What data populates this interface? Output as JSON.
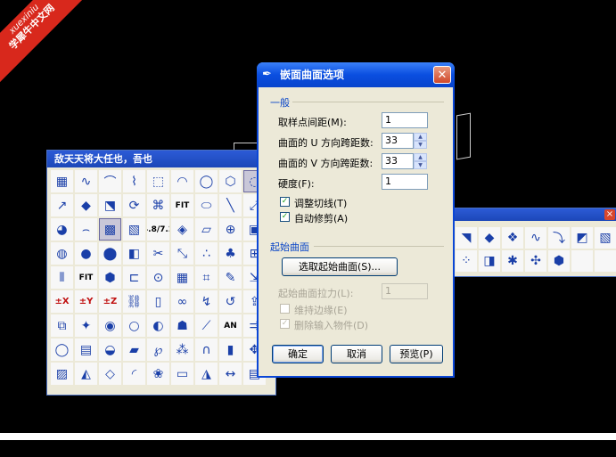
{
  "watermark": {
    "line1": "xuexiniu",
    "line2": "学犀牛中文网"
  },
  "left_toolbar": {
    "title": "敌天天将大任也，吾也",
    "tools": [
      {
        "icon": "color-swatch-icon",
        "glyph": "▦"
      },
      {
        "icon": "curve-icon",
        "glyph": "∿"
      },
      {
        "icon": "polyline-icon",
        "glyph": "⌒"
      },
      {
        "icon": "freeform-curve-icon",
        "glyph": "⌇"
      },
      {
        "icon": "rectangle-dashed-icon",
        "glyph": "⬚"
      },
      {
        "icon": "arc-icon",
        "glyph": "◠"
      },
      {
        "icon": "circle-icon",
        "glyph": "◯"
      },
      {
        "icon": "polygon-icon",
        "glyph": "⬡"
      },
      {
        "icon": "ellipse-icon",
        "glyph": "◌"
      },
      {
        "icon": "line-arrow-icon",
        "glyph": "↗"
      },
      {
        "icon": "surface-icon",
        "glyph": "◆"
      },
      {
        "icon": "loft-icon",
        "glyph": "⬔"
      },
      {
        "icon": "revolve-icon",
        "glyph": "⟳"
      },
      {
        "icon": "sweep-icon",
        "glyph": "⌘"
      },
      {
        "icon": "fit-icon",
        "glyph": "FIT"
      },
      {
        "icon": "cylinder-icon",
        "glyph": "⬭"
      },
      {
        "icon": "pipe-icon",
        "glyph": "╲"
      },
      {
        "icon": "extend-icon",
        "glyph": "⤢"
      },
      {
        "icon": "fillet-icon",
        "glyph": "◕"
      },
      {
        "icon": "blend-icon",
        "glyph": "⌢"
      },
      {
        "icon": "patch-icon",
        "glyph": "▩"
      },
      {
        "icon": "network-surface-icon",
        "glyph": "▧"
      },
      {
        "icon": "fraction-icon",
        "glyph": "4.8/7.2"
      },
      {
        "icon": "plane-icon",
        "glyph": "◈"
      },
      {
        "icon": "offset-icon",
        "glyph": "▱"
      },
      {
        "icon": "sphere-wire-icon",
        "glyph": "⊕"
      },
      {
        "icon": "box-icon",
        "glyph": "▣"
      },
      {
        "icon": "sphere-icon",
        "glyph": "◍"
      },
      {
        "icon": "ball-icon",
        "glyph": "●"
      },
      {
        "icon": "solid-sphere-icon",
        "glyph": "⬤"
      },
      {
        "icon": "split-icon",
        "glyph": "◧"
      },
      {
        "icon": "trim-icon",
        "glyph": "✂"
      },
      {
        "icon": "scale-icon",
        "glyph": "⤡"
      },
      {
        "icon": "points-icon",
        "glyph": "∴"
      },
      {
        "icon": "group-icon",
        "glyph": "♣"
      },
      {
        "icon": "select-icon",
        "glyph": "⊞"
      },
      {
        "icon": "mirror-icon",
        "glyph": "⫴"
      },
      {
        "icon": "fit-curve-icon",
        "glyph": "FIT"
      },
      {
        "icon": "cube-icon",
        "glyph": "⬢"
      },
      {
        "icon": "explode-icon",
        "glyph": "⊏"
      },
      {
        "icon": "target-icon",
        "glyph": "⊙"
      },
      {
        "icon": "hatch-icon",
        "glyph": "▦"
      },
      {
        "icon": "grid-icon",
        "glyph": "⌗"
      },
      {
        "icon": "brush-icon",
        "glyph": "✎"
      },
      {
        "icon": "move-icon",
        "glyph": "⇲"
      },
      {
        "icon": "dim-x-icon",
        "glyph": "±X"
      },
      {
        "icon": "dim-y-icon",
        "glyph": "±Y"
      },
      {
        "icon": "dim-z-icon",
        "glyph": "±Z"
      },
      {
        "icon": "chain-icon",
        "glyph": "⛓"
      },
      {
        "icon": "edge-icon",
        "glyph": "▯"
      },
      {
        "icon": "link-icon",
        "glyph": "∞"
      },
      {
        "icon": "path-icon",
        "glyph": "↯"
      },
      {
        "icon": "loop-icon",
        "glyph": "↺"
      },
      {
        "icon": "extrude-icon",
        "glyph": "⇪"
      },
      {
        "icon": "layout-icon",
        "glyph": "⧉"
      },
      {
        "icon": "render-icon",
        "glyph": "✦"
      },
      {
        "icon": "light-icon",
        "glyph": "◉"
      },
      {
        "icon": "sphere-light-icon",
        "glyph": "○"
      },
      {
        "icon": "globe-icon",
        "glyph": "◐"
      },
      {
        "icon": "walk-icon",
        "glyph": "☗"
      },
      {
        "icon": "measure-icon",
        "glyph": "⟋"
      },
      {
        "icon": "annotation-icon",
        "glyph": "AN"
      },
      {
        "icon": "arrows-icon",
        "glyph": "⇉"
      },
      {
        "icon": "circle-red-icon",
        "glyph": "◯"
      },
      {
        "icon": "gradient-icon",
        "glyph": "▤"
      },
      {
        "icon": "disc-icon",
        "glyph": "◒"
      },
      {
        "icon": "panel-icon",
        "glyph": "▰"
      },
      {
        "icon": "loop-curve-icon",
        "glyph": "℘"
      },
      {
        "icon": "scatter-icon",
        "glyph": "⁂"
      },
      {
        "icon": "arch-icon",
        "glyph": "∩"
      },
      {
        "icon": "block-icon",
        "glyph": "▮"
      },
      {
        "icon": "pan-icon",
        "glyph": "✥"
      },
      {
        "icon": "stripes-icon",
        "glyph": "▨"
      },
      {
        "icon": "shaded-icon",
        "glyph": "◭"
      },
      {
        "icon": "tile-icon",
        "glyph": "◇"
      },
      {
        "icon": "ribbon-icon",
        "glyph": "◜"
      },
      {
        "icon": "material-icon",
        "glyph": "❀"
      },
      {
        "icon": "paper-icon",
        "glyph": "▭"
      },
      {
        "icon": "mesh-icon",
        "glyph": "◮"
      },
      {
        "icon": "dimension-icon",
        "glyph": "↔"
      },
      {
        "icon": "toolbar-icon",
        "glyph": "▤"
      }
    ]
  },
  "right_toolbar": {
    "close": "×",
    "tools": [
      {
        "icon": "surface-edge-icon",
        "glyph": "◥"
      },
      {
        "icon": "surface-tile-icon",
        "glyph": "◆"
      },
      {
        "icon": "diamonds-icon",
        "glyph": "❖"
      },
      {
        "icon": "wave-icon",
        "glyph": "∿"
      },
      {
        "icon": "twist-icon",
        "glyph": "⤵"
      },
      {
        "icon": "flag-icon",
        "glyph": "◩"
      },
      {
        "icon": "strip-icon",
        "glyph": "▧"
      },
      {
        "icon": "dots-icon",
        "glyph": "⁘"
      },
      {
        "icon": "frame-icon",
        "glyph": "◨"
      },
      {
        "icon": "star-icon",
        "glyph": "✱"
      },
      {
        "icon": "satellite-icon",
        "glyph": "✣"
      },
      {
        "icon": "box3d-icon",
        "glyph": "⬢"
      },
      {
        "icon": "blank1-icon",
        "glyph": ""
      },
      {
        "icon": "blank2-icon",
        "glyph": ""
      }
    ]
  },
  "dialog": {
    "title": "嵌面曲面选项",
    "close": "✕",
    "app_icon": "✒",
    "group_general": "一般",
    "sample_spacing_label": "取样点间距(M):",
    "sample_spacing_value": "1",
    "u_span_label": "曲面的 U 方向跨距数:",
    "u_span_value": "33",
    "v_span_label": "曲面的 V 方向跨距数:",
    "v_span_value": "33",
    "stiffness_label": "硬度(F):",
    "stiffness_value": "1",
    "adjust_tangency_label": "调整切线(T)",
    "auto_trim_label": "自动修剪(A)",
    "group_start": "起始曲面",
    "select_start_label": "选取起始曲面(S)...",
    "start_pull_label": "起始曲面拉力(L):",
    "start_pull_value": "1",
    "keep_edges_label": "维持边缘(E)",
    "delete_input_label": "删除输入物件(D)",
    "ok_label": "确定",
    "cancel_label": "取消",
    "preview_label": "预览(P)",
    "spin_up": "▲",
    "spin_down": "▼",
    "check_mark": "✓"
  }
}
